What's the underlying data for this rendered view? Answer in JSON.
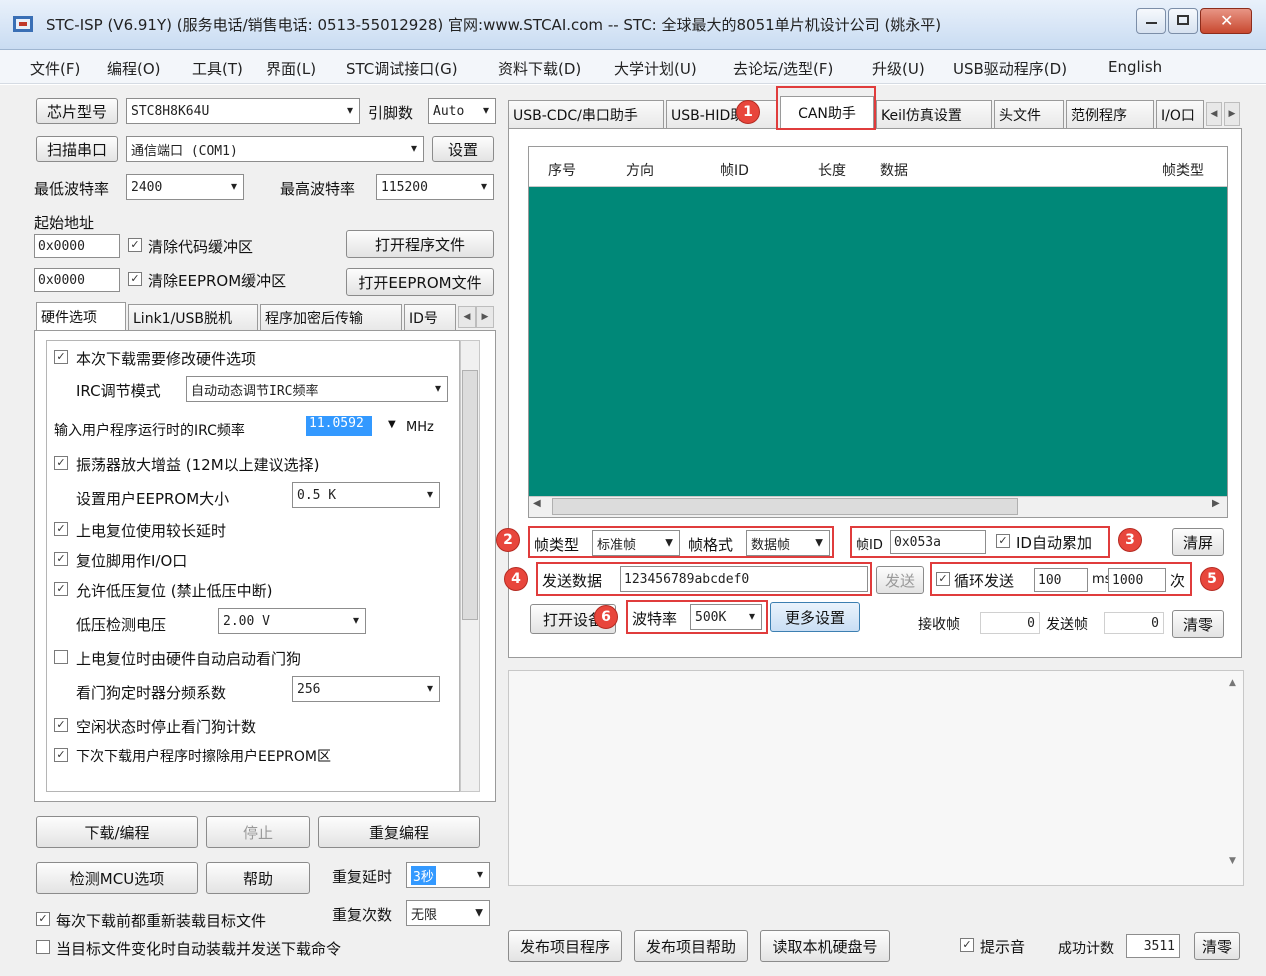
{
  "window": {
    "title": "STC-ISP (V6.91Y) (服务电话/销售电话: 0513-55012928) 官网:www.STCAI.com  -- STC: 全球最大的8051单片机设计公司 (姚永平)"
  },
  "menu": [
    "文件(F)",
    "编程(O)",
    "工具(T)",
    "界面(L)",
    "STC调试接口(G)",
    "资料下载(D)",
    "大学计划(U)",
    "去论坛/选型(F)",
    "升级(U)",
    "USB驱动程序(D)",
    "English"
  ],
  "left": {
    "chip_label": "芯片型号",
    "chip_value": "STC8H8K64U",
    "pins_label": "引脚数",
    "pins_value": "Auto",
    "scan_label": "扫描串口",
    "port_value": "通信端口 (COM1)",
    "settings_label": "设置",
    "min_baud_label": "最低波特率",
    "min_baud_value": "2400",
    "max_baud_label": "最高波特率",
    "max_baud_value": "115200",
    "start_addr_label": "起始地址",
    "addr1": "0x0000",
    "addr2": "0x0000",
    "clear_code_label": "清除代码缓冲区",
    "clear_eeprom_label": "清除EEPROM缓冲区",
    "open_prog_label": "打开程序文件",
    "open_eeprom_label": "打开EEPROM文件",
    "tabs": [
      "硬件选项",
      "Link1/USB脱机",
      "程序加密后传输",
      "ID号"
    ],
    "options": {
      "opt1": "本次下载需要修改硬件选项",
      "irc_mode_label": "IRC调节模式",
      "irc_mode_value": "自动动态调节IRC频率",
      "irc_freq_label": "输入用户程序运行时的IRC频率",
      "irc_freq_value": "11.0592",
      "irc_unit": "MHz",
      "opt2": "振荡器放大增益 (12M以上建议选择)",
      "eeprom_size_label": "设置用户EEPROM大小",
      "eeprom_size_value": "0.5 K",
      "opt3": "上电复位使用较长延时",
      "opt4": "复位脚用作I/O口",
      "opt5": "允许低压复位 (禁止低压中断)",
      "lvd_label": "低压检测电压",
      "lvd_value": "2.00 V",
      "opt6": "上电复位时由硬件自动启动看门狗",
      "wdt_label": "看门狗定时器分频系数",
      "wdt_value": "256",
      "opt7": "空闲状态时停止看门狗计数",
      "opt8": "下次下载用户程序时擦除用户EEPROM区"
    },
    "download_label": "下载/编程",
    "stop_label": "停止",
    "reprogram_label": "重复编程",
    "check_mcu_label": "检测MCU选项",
    "help_label": "帮助",
    "retry_delay_label": "重复延时",
    "retry_delay_value": "3秒",
    "retry_count_label": "重复次数",
    "retry_count_value": "无限",
    "reload_label": "每次下载前都重新装载目标文件",
    "auto_load_label": "当目标文件变化时自动装载并发送下载命令"
  },
  "right": {
    "tabs": [
      "USB-CDC/串口助手",
      "USB-HID助手",
      "CAN助手",
      "Keil仿真设置",
      "头文件",
      "范例程序",
      "I/O口"
    ],
    "grid_headers": [
      "序号",
      "方向",
      "帧ID",
      "长度",
      "数据",
      "帧类型"
    ],
    "frame_type_label": "帧类型",
    "frame_type_value": "标准帧",
    "frame_format_label": "帧格式",
    "frame_format_value": "数据帧",
    "frame_id_label": "帧ID",
    "frame_id_value": "0x053a",
    "id_auto_label": "ID自动累加",
    "clear_screen_label": "清屏",
    "send_data_label": "发送数据",
    "send_data_value": "123456789abcdef0",
    "send_label": "发送",
    "loop_send_label": "循环发送",
    "loop_interval": "100",
    "loop_unit": "ms",
    "loop_count": "1000",
    "loop_count_unit": "次",
    "open_port_label": "打开设备",
    "baud_label": "波特率",
    "baud_value": "500K",
    "more_settings_label": "更多设置",
    "rx_frames_label": "接收帧",
    "rx_frames_value": "0",
    "tx_frames_label": "发送帧",
    "tx_frames_value": "0",
    "clear_count_label": "清零",
    "badges": [
      "1",
      "2",
      "3",
      "4",
      "5",
      "6"
    ],
    "publish_prog_label": "发布项目程序",
    "publish_help_label": "发布项目帮助",
    "read_serial_label": "读取本机硬盘号",
    "beep_label": "提示音",
    "success_count_label": "成功计数",
    "success_count_value": "3511",
    "clear_success_label": "清零"
  },
  "colors": {
    "grid_bg": "#008878",
    "highlight": "#e03c3c",
    "selected_text_bg": "#3399ff"
  }
}
